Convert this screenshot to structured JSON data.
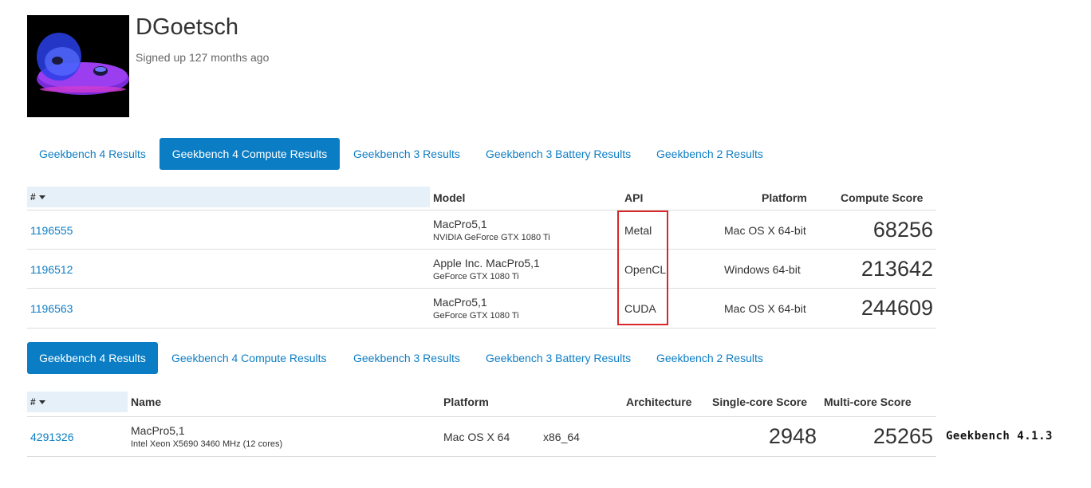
{
  "profile": {
    "username": "DGoetsch",
    "signed_up": "Signed up 127 months ago"
  },
  "tabs_top": [
    {
      "label": "Geekbench 4 Results",
      "active": false
    },
    {
      "label": "Geekbench 4 Compute Results",
      "active": true
    },
    {
      "label": "Geekbench 3 Results",
      "active": false
    },
    {
      "label": "Geekbench 3 Battery Results",
      "active": false
    },
    {
      "label": "Geekbench 2 Results",
      "active": false
    }
  ],
  "compute_table": {
    "headers": {
      "id": "#",
      "model": "Model",
      "api": "API",
      "platform": "Platform",
      "score": "Compute Score"
    },
    "rows": [
      {
        "id": "1196555",
        "model": "MacPro5,1",
        "gpu": "NVIDIA GeForce GTX 1080 Ti",
        "api": "Metal",
        "platform": "Mac OS X 64-bit",
        "score": "68256"
      },
      {
        "id": "1196512",
        "model": "Apple Inc. MacPro5,1",
        "gpu": "GeForce GTX 1080 Ti",
        "api": "OpenCL",
        "platform": "Windows 64-bit",
        "score": "213642"
      },
      {
        "id": "1196563",
        "model": "MacPro5,1",
        "gpu": "GeForce GTX 1080 Ti",
        "api": "CUDA",
        "platform": "Mac OS X 64-bit",
        "score": "244609"
      }
    ]
  },
  "tabs_bottom": [
    {
      "label": "Geekbench 4 Results",
      "active": true
    },
    {
      "label": "Geekbench 4 Compute Results",
      "active": false
    },
    {
      "label": "Geekbench 3 Results",
      "active": false
    },
    {
      "label": "Geekbench 3 Battery Results",
      "active": false
    },
    {
      "label": "Geekbench 2 Results",
      "active": false
    }
  ],
  "cpu_table": {
    "headers": {
      "id": "#",
      "name": "Name",
      "platform": "Platform",
      "arch": "Architecture",
      "single": "Single-core Score",
      "multi": "Multi-core Score"
    },
    "rows": [
      {
        "id": "4291326",
        "name": "MacPro5,1",
        "cpu": "Intel Xeon X5690 3460 MHz (12 cores)",
        "platform": "Mac OS X 64",
        "arch": "x86_64",
        "single": "2948",
        "multi": "25265"
      }
    ]
  },
  "annotation": {
    "version_label": "Geekbench 4.1.3",
    "highlight_color": "#d8262b"
  },
  "colors": {
    "link": "#0d7ec4",
    "active_tab_bg": "#0b7dc4",
    "sort_header_bg": "#e6f0f8"
  }
}
